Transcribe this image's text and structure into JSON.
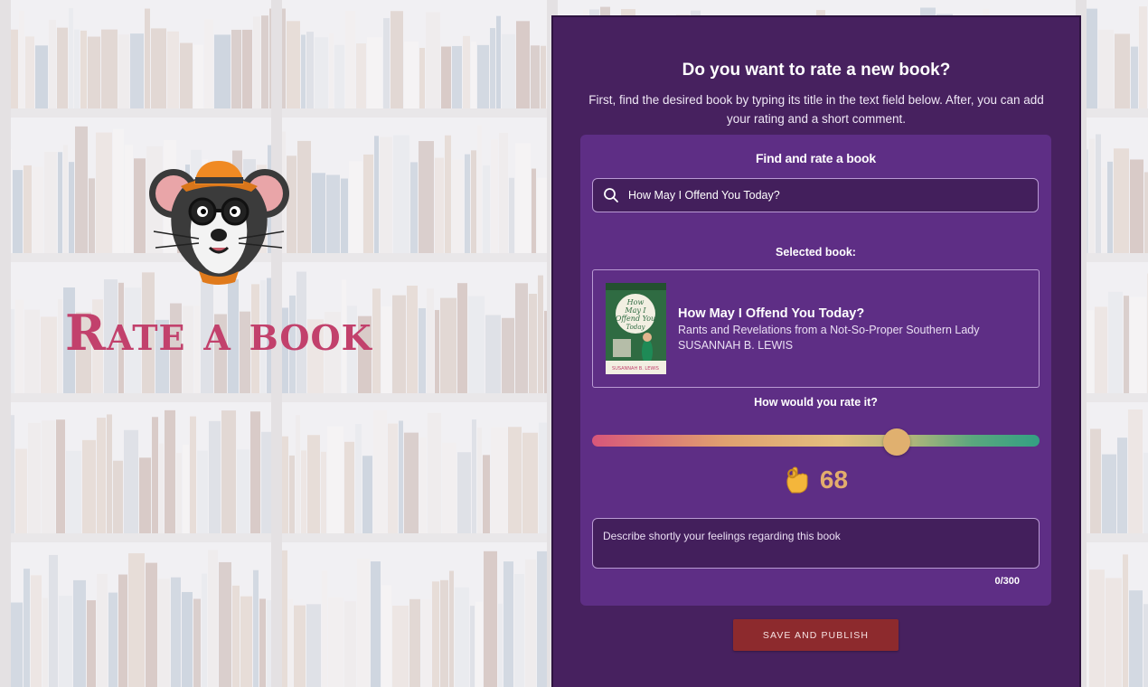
{
  "brand": {
    "title": "Rate a book",
    "mascot": "rat-with-glasses-and-hat-logo"
  },
  "header": {
    "title": "Do you want to rate a new book?",
    "description": "First, find the desired book by typing its title in the text field below. After, you can add your rating and a short comment."
  },
  "finder": {
    "heading": "Find and rate a book",
    "search_icon": "search-icon",
    "search_value": "How May I Offend You Today?",
    "selected_label": "Selected book:"
  },
  "book": {
    "title": "How May I Offend You Today?",
    "subtitle": "Rants and Revelations from a Not-So-Proper Southern Lady",
    "author": "SUSANNAH B. LEWIS",
    "cover_title": "How May I Offend You Today",
    "cover_author": "SUSANNAH B. LEWIS"
  },
  "rating": {
    "label": "How would you rate it?",
    "value": 68,
    "value_text": "68",
    "min": 0,
    "max": 100,
    "emoji_icon": "ok-hand-icon"
  },
  "comment": {
    "placeholder": "Describe shortly your feelings regarding this book",
    "value": "",
    "counter": "0/300"
  },
  "actions": {
    "save_label": "SAVE AND PUBLISH"
  },
  "colors": {
    "panel": "#47215f",
    "card": "#5e2e85",
    "accent": "#e3ad6c",
    "brand": "#c2416c",
    "button": "#8d2a2d"
  }
}
